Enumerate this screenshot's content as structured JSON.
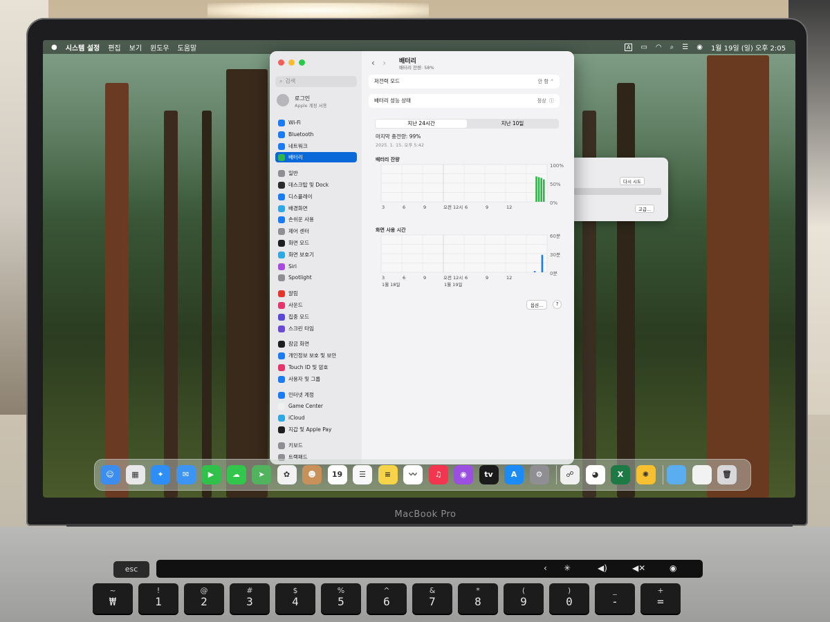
{
  "menubar": {
    "app": "시스템 설정",
    "items": [
      "편집",
      "보기",
      "윈도우",
      "도움말"
    ],
    "clock": "1월 19일 (일) 오후 2:05",
    "input_indicator": "A"
  },
  "sidebar": {
    "search_placeholder": "검색",
    "account_name": "로그인",
    "account_sub": "Apple 계정 서용",
    "items": [
      {
        "label": "Wi-Fi",
        "icon": "wifi-icon",
        "color": "#1a7cf5"
      },
      {
        "label": "Bluetooth",
        "icon": "bluetooth-icon",
        "color": "#1a7cf5"
      },
      {
        "label": "네트워크",
        "icon": "globe-icon",
        "color": "#1a7cf5"
      },
      {
        "label": "배터리",
        "icon": "battery-icon",
        "color": "#2fb64a",
        "selected": true
      },
      {
        "label": "일반",
        "icon": "gear-icon",
        "color": "#8e8e93"
      },
      {
        "label": "데스크탑 및 Dock",
        "icon": "dock-icon",
        "color": "#2b2b2b"
      },
      {
        "label": "디스플레이",
        "icon": "sun-icon",
        "color": "#1a7cf5"
      },
      {
        "label": "배경화면",
        "icon": "flower-icon",
        "color": "#2fa8e6"
      },
      {
        "label": "손쉬운 사용",
        "icon": "accessibility-icon",
        "color": "#1a7cf5"
      },
      {
        "label": "제어 센터",
        "icon": "toggles-icon",
        "color": "#8e8e93"
      },
      {
        "label": "화면 모드",
        "icon": "appearance-icon",
        "color": "#1e1e1e"
      },
      {
        "label": "화면 보호기",
        "icon": "screensaver-icon",
        "color": "#2fa8e6"
      },
      {
        "label": "Siri",
        "icon": "siri-icon",
        "color": "#a84be0"
      },
      {
        "label": "Spotlight",
        "icon": "search-icon",
        "color": "#8e8e93"
      },
      {
        "label": "알림",
        "icon": "bell-icon",
        "color": "#e6352b"
      },
      {
        "label": "사운드",
        "icon": "speaker-icon",
        "color": "#e6356a"
      },
      {
        "label": "집중 모드",
        "icon": "moon-icon",
        "color": "#5b4ad6"
      },
      {
        "label": "스크린 타임",
        "icon": "hourglass-icon",
        "color": "#6b4ad6"
      },
      {
        "label": "잠금 화면",
        "icon": "lock-icon",
        "color": "#1e1e1e"
      },
      {
        "label": "개인정보 보호 및 보안",
        "icon": "hand-icon",
        "color": "#1a7cf5"
      },
      {
        "label": "Touch ID 및 암호",
        "icon": "fingerprint-icon",
        "color": "#e6356a"
      },
      {
        "label": "사용자 및 그룹",
        "icon": "users-icon",
        "color": "#1a7cf5"
      },
      {
        "label": "인터넷 계정",
        "icon": "at-icon",
        "color": "#1a7cf5"
      },
      {
        "label": "Game Center",
        "icon": "gamecenter-icon",
        "color": "#f0f0f0"
      },
      {
        "label": "iCloud",
        "icon": "cloud-icon",
        "color": "#2fa8e6"
      },
      {
        "label": "지갑 및 Apple Pay",
        "icon": "wallet-icon",
        "color": "#1e1e1e"
      },
      {
        "label": "키보드",
        "icon": "keyboard-icon",
        "color": "#8e8e93"
      },
      {
        "label": "트랙패드",
        "icon": "trackpad-icon",
        "color": "#8e8e93"
      }
    ]
  },
  "battery": {
    "title": "배터리",
    "subtitle": "배터리 잔량: 58%",
    "low_power_label": "저전력 모드",
    "low_power_value": "안 함",
    "health_label": "배터리 성능 상태",
    "health_value": "정상",
    "tabs": [
      "지난 24시간",
      "지난 10일"
    ],
    "last_charge": "마지막 충전량: 99%",
    "last_charge_date": "2025. 1. 15. 오후 5:42",
    "options_button": "옵션...",
    "help_button": "?"
  },
  "chart_data": [
    {
      "type": "bar",
      "title": "배터리 잔량",
      "x_ticks": [
        "3",
        "6",
        "9",
        "오전 12시",
        "6",
        "9",
        "12"
      ],
      "y_ticks": [
        "100%",
        "50%",
        "0%"
      ],
      "ylim": [
        0,
        100
      ],
      "bars": [
        {
          "pos": 0.93,
          "value": 68
        },
        {
          "pos": 0.945,
          "value": 66
        },
        {
          "pos": 0.96,
          "value": 64
        },
        {
          "pos": 0.975,
          "value": 60
        }
      ],
      "bar_color": "#2fb64a"
    },
    {
      "type": "bar",
      "title": "화면 사용 시간",
      "x_ticks": [
        "3",
        "6",
        "9",
        "오전 12시",
        "6",
        "9",
        "12"
      ],
      "x_dates": [
        "1월 18일",
        "1월 19일"
      ],
      "y_ticks": [
        "60분",
        "30분",
        "0분"
      ],
      "ylim": [
        0,
        60
      ],
      "bars": [
        {
          "pos": 0.92,
          "value": 2
        },
        {
          "pos": 0.965,
          "value": 28
        }
      ],
      "bar_color": "#1a7cf5"
    }
  ],
  "dialog": {
    "retry_button": "다시 시도",
    "advanced_button": "고급..."
  },
  "dock": [
    {
      "name": "finder-icon",
      "color": "#3b8df0",
      "glyph": "☺"
    },
    {
      "name": "launchpad-icon",
      "color": "#e8e8ea",
      "glyph": "▦"
    },
    {
      "name": "safari-icon",
      "color": "#2e8ef5",
      "glyph": "✦"
    },
    {
      "name": "mail-icon",
      "color": "#3d95f3",
      "glyph": "✉"
    },
    {
      "name": "facetime-icon",
      "color": "#2fc14a",
      "glyph": "▶"
    },
    {
      "name": "messages-icon",
      "color": "#33c64c",
      "glyph": "☁"
    },
    {
      "name": "maps-icon",
      "color": "#52b35e",
      "glyph": "➤"
    },
    {
      "name": "photos-icon",
      "color": "#f2f2f2",
      "glyph": "✿"
    },
    {
      "name": "contacts-icon",
      "color": "#c9915a",
      "glyph": "☻"
    },
    {
      "name": "calendar-icon",
      "color": "#ffffff",
      "glyph": "19"
    },
    {
      "name": "reminders-icon",
      "color": "#f7f7f7",
      "glyph": "☰"
    },
    {
      "name": "notes-icon",
      "color": "#f7d34a",
      "glyph": "≡"
    },
    {
      "name": "freeform-icon",
      "color": "#ffffff",
      "glyph": "〰"
    },
    {
      "name": "music-icon",
      "color": "#f2364f",
      "glyph": "♫"
    },
    {
      "name": "podcasts-icon",
      "color": "#9b4fe0",
      "glyph": "◉"
    },
    {
      "name": "tv-icon",
      "color": "#1b1b1b",
      "glyph": "tv"
    },
    {
      "name": "appstore-icon",
      "color": "#1d8bf5",
      "glyph": "A"
    },
    {
      "name": "system-settings-icon",
      "color": "#8e8e93",
      "glyph": "⚙"
    },
    {
      "name": "preview-icon",
      "color": "#f0f0f0",
      "glyph": "☍"
    },
    {
      "name": "chrome-icon",
      "color": "#ffffff",
      "glyph": "◕"
    },
    {
      "name": "excel-icon",
      "color": "#1e7a45",
      "glyph": "X"
    },
    {
      "name": "tips-icon",
      "color": "#f6c030",
      "glyph": "✺"
    },
    {
      "name": "downloads-folder-icon",
      "color": "#5aaef0",
      "glyph": ""
    },
    {
      "name": "document-folder-icon",
      "color": "#f2f2f2",
      "glyph": ""
    },
    {
      "name": "trash-icon",
      "color": "#d8d8da",
      "glyph": "🗑"
    }
  ],
  "laptop_label": "MacBook Pro",
  "keyboard": {
    "esc": "esc",
    "rows": [
      [
        [
          "~",
          "₩"
        ],
        [
          "!",
          "1"
        ],
        [
          "@",
          "2"
        ],
        [
          "#",
          "3"
        ],
        [
          "$",
          "4"
        ],
        [
          "%",
          "5"
        ],
        [
          "^",
          "6"
        ],
        [
          "&",
          "7"
        ],
        [
          "*",
          "8"
        ],
        [
          "(",
          "9"
        ],
        [
          ")",
          "0"
        ],
        [
          "_",
          "-"
        ],
        [
          "+",
          "="
        ]
      ]
    ]
  }
}
